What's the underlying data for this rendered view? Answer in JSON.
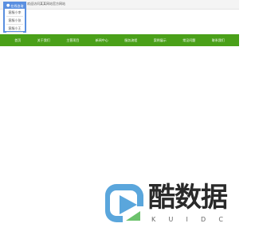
{
  "topbar": {
    "note": "欢迎访问某某网站官方网站"
  },
  "service": {
    "title": "在线咨询",
    "items": [
      "客服小李",
      "客服小张",
      "客服小王"
    ]
  },
  "nav": {
    "items": [
      "首页",
      "关于我们",
      "主营项目",
      "新闻中心",
      "服务流程",
      "案例展示",
      "常见问题",
      "联系我们"
    ]
  },
  "logo": {
    "title": "酷数据",
    "sub_letters": [
      "K",
      "U",
      "I",
      "D",
      "C"
    ]
  },
  "colors": {
    "nav_bg": "#4aa019",
    "service_accent": "#5a8fe0",
    "logo_blue": "#5aa6dc",
    "logo_green": "#6cc26c"
  }
}
